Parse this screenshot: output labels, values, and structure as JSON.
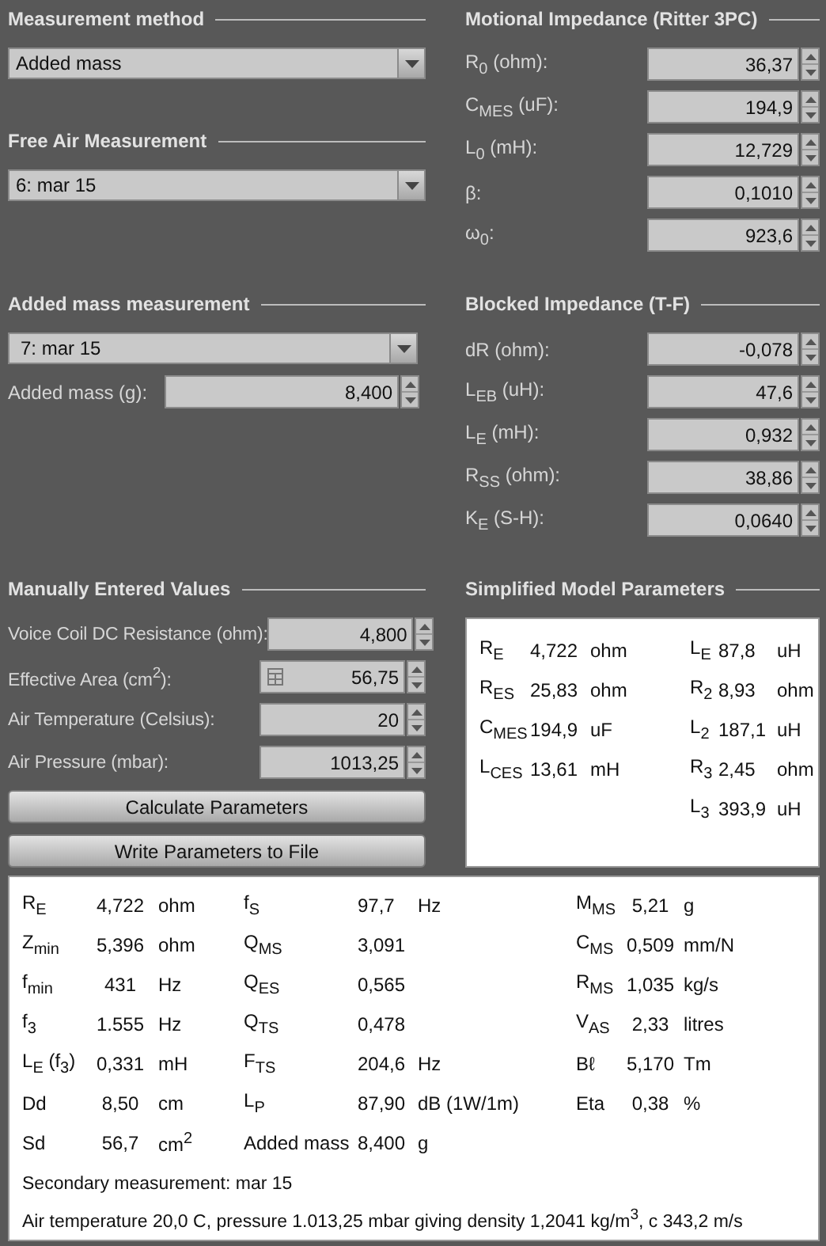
{
  "measurement_method": {
    "title": "Measurement method",
    "dropdown": {
      "value": "Added mass"
    }
  },
  "free_air_measurement": {
    "title": "Free Air Measurement",
    "dropdown": {
      "value": "6: mar 15"
    }
  },
  "added_mass_measurement": {
    "title": "Added mass measurement",
    "dropdown": {
      "value": "7: mar 15"
    },
    "field": {
      "label": "Added mass (g):",
      "value": "8,400"
    }
  },
  "manually_entered_values": {
    "title": "Manually Entered Values",
    "fields": [
      {
        "label": "Voice Coil DC Resistance (ohm):",
        "value": "4,800",
        "calculator": false
      },
      {
        "label": "Effective Area (cm$^{2}$):",
        "value": "56,75",
        "calculator": true
      },
      {
        "label": "Air Temperature (Celsius):",
        "value": "20",
        "calculator": false
      },
      {
        "label": "Air Pressure (mbar):",
        "value": "1013,25",
        "calculator": false
      }
    ],
    "buttons": [
      "Calculate Parameters",
      "Write Parameters to File"
    ]
  },
  "motional_impedance": {
    "title": "Motional Impedance (Ritter 3PC)",
    "fields": [
      {
        "label": "R$_{0}$ (ohm):",
        "value": "36,37"
      },
      {
        "label": "C$_{MES}$ (uF):",
        "value": "194,9"
      },
      {
        "label": "L$_{0}$ (mH):",
        "value": "12,729"
      },
      {
        "label": "β:",
        "value": "0,1010"
      },
      {
        "label": "ω$_{0}$:",
        "value": "923,6"
      }
    ]
  },
  "blocked_impedance": {
    "title": "Blocked Impedance (T-F)",
    "fields": [
      {
        "label": "dR (ohm):",
        "value": "-0,078"
      },
      {
        "label": "L$_{EB}$ (uH):",
        "value": "47,6"
      },
      {
        "label": "L$_{E}$ (mH):",
        "value": "0,932"
      },
      {
        "label": "R$_{SS}$ (ohm):",
        "value": "38,86"
      },
      {
        "label": "K$_{E}$ (S-H):",
        "value": "0,0640"
      }
    ]
  },
  "simplified_model_parameters": {
    "title": "Simplified Model Parameters",
    "columns": [
      [
        {
          "symbol": "R$_{E}$",
          "value": "4,722",
          "unit": "ohm"
        },
        {
          "symbol": "R$_{ES}$",
          "value": "25,83",
          "unit": "ohm"
        },
        {
          "symbol": "C$_{MES}$",
          "value": "194,9",
          "unit": "uF"
        },
        {
          "symbol": "L$_{CES}$",
          "value": "13,61",
          "unit": "mH"
        }
      ],
      [
        {
          "symbol": "L$_{E}$",
          "value": "87,8",
          "unit": "uH"
        },
        {
          "symbol": "R$_{2}$",
          "value": "8,93",
          "unit": "ohm"
        },
        {
          "symbol": "L$_{2}$",
          "value": "187,1",
          "unit": "uH"
        },
        {
          "symbol": "R$_{3}$",
          "value": "2,45",
          "unit": "ohm"
        },
        {
          "symbol": "L$_{3}$",
          "value": "393,9",
          "unit": "uH"
        }
      ]
    ]
  },
  "results": {
    "columns": [
      [
        {
          "symbol": "R$_{E}$",
          "value": "4,722",
          "unit": "ohm"
        },
        {
          "symbol": "Z$_{min}$",
          "value": "5,396",
          "unit": "ohm"
        },
        {
          "symbol": "f$_{min}$",
          "value": "431",
          "unit": "Hz"
        },
        {
          "symbol": "f$_{3}$",
          "value": "1.555",
          "unit": "Hz"
        },
        {
          "symbol": "L$_{E}$ (f$_{3}$)",
          "value": "0,331",
          "unit": "mH"
        },
        {
          "symbol": "Dd",
          "value": "8,50",
          "unit": "cm"
        },
        {
          "symbol": "Sd",
          "value": "56,7",
          "unit": "cm$^{2}$"
        }
      ],
      [
        {
          "symbol": "f$_{S}$",
          "value": "97,7",
          "unit": "Hz"
        },
        {
          "symbol": "Q$_{MS}$",
          "value": "3,091"
        },
        {
          "symbol": "Q$_{ES}$",
          "value": "0,565"
        },
        {
          "symbol": "Q$_{TS}$",
          "value": "0,478"
        },
        {
          "symbol": "F$_{TS}$",
          "value": "204,6",
          "unit": "Hz"
        },
        {
          "symbol": "L$_{P}$",
          "value": "87,90",
          "unit": "dB (1W/1m)"
        },
        {
          "symbol": "Added mass",
          "value": "8,400",
          "unit": "g"
        }
      ],
      [
        {
          "symbol": "M$_{MS}$",
          "value": "5,21",
          "unit": "g"
        },
        {
          "symbol": "C$_{MS}$",
          "value": "0,509",
          "unit": "mm/N"
        },
        {
          "symbol": "R$_{MS}$",
          "value": "1,035",
          "unit": "kg/s"
        },
        {
          "symbol": "V$_{AS}$",
          "value": "2,33",
          "unit": "litres"
        },
        {
          "symbol": "Bℓ",
          "value": "5,170",
          "unit": "Tm"
        },
        {
          "symbol": "Eta",
          "value": "0,38",
          "unit": "%"
        }
      ]
    ],
    "notes": [
      "Secondary measurement: mar 15",
      "Air temperature 20,0 C, pressure 1.013,25 mbar giving density 1,2041 kg/m$^{3}$, c 343,2 m/s"
    ]
  }
}
